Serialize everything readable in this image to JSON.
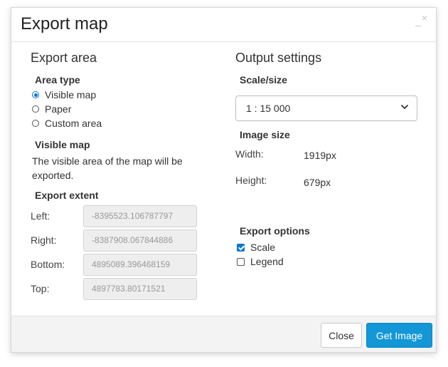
{
  "dialog": {
    "title": "Export map",
    "minimize_glyph": "_",
    "close_glyph": "×"
  },
  "export_area": {
    "heading": "Export area",
    "area_type_label": "Area type",
    "options": [
      {
        "label": "Visible map",
        "checked": true
      },
      {
        "label": "Paper",
        "checked": false
      },
      {
        "label": "Custom area",
        "checked": false
      }
    ],
    "visible_map_label": "Visible map",
    "visible_map_desc_line1": "The visible area of the map will be",
    "visible_map_desc_line2": "exported.",
    "extent_label": "Export extent",
    "extent": {
      "left": {
        "label": "Left:",
        "value": "-8395523.106787797"
      },
      "right": {
        "label": "Right:",
        "value": "-8387908.067844886"
      },
      "bottom": {
        "label": "Bottom:",
        "value": "4895089.396468159"
      },
      "top": {
        "label": "Top:",
        "value": "4897783.80171521"
      }
    }
  },
  "output_settings": {
    "heading": "Output settings",
    "scale_label": "Scale/size",
    "scale_value": "1 : 15 000",
    "image_size_label": "Image size",
    "width_label": "Width:",
    "width_value": "1919px",
    "height_label": "Height:",
    "height_value": "679px",
    "export_options_label": "Export options",
    "options": [
      {
        "label": "Scale",
        "checked": true
      },
      {
        "label": "Legend",
        "checked": false
      }
    ]
  },
  "footer": {
    "close_label": "Close",
    "get_image_label": "Get Image"
  },
  "colors": {
    "accent": "#0b76d8",
    "primary_button": "#1397d6"
  }
}
